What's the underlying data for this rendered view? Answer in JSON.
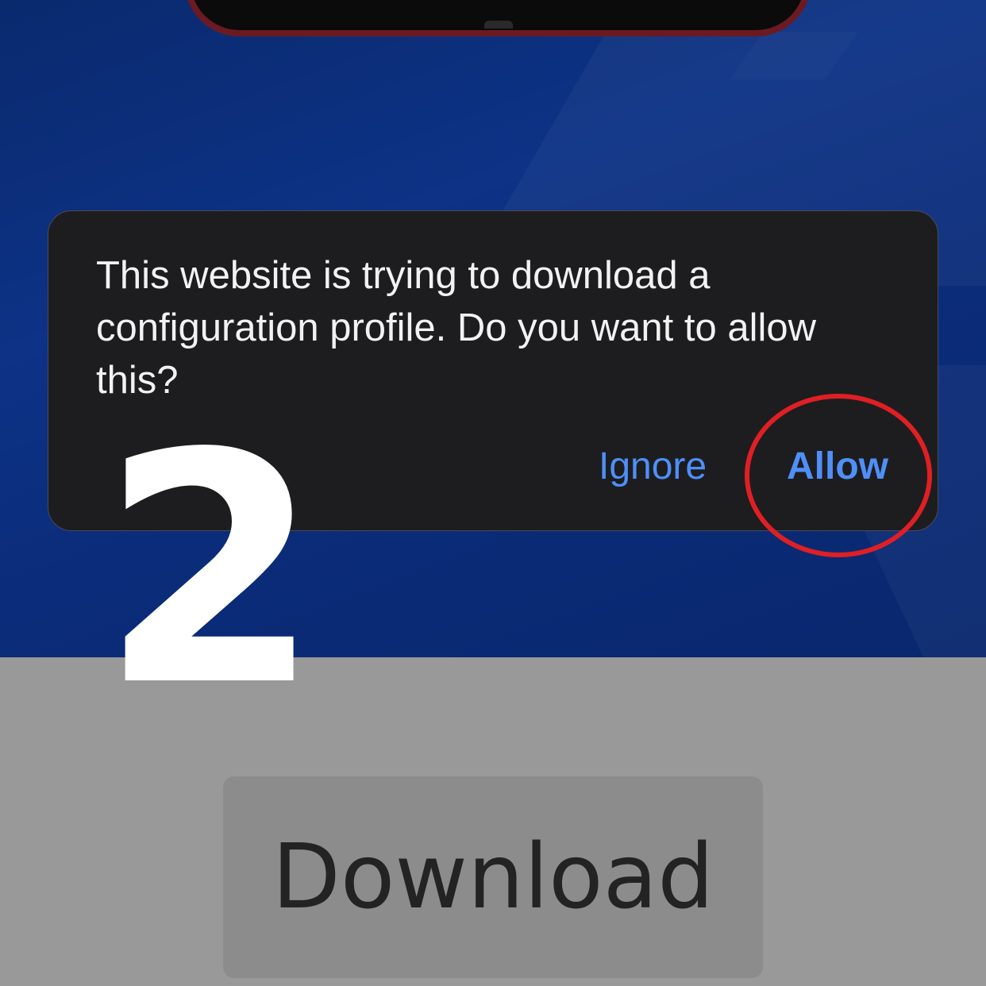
{
  "alert": {
    "message": "This website is trying to download a configuration profile. Do you want to allow this?",
    "ignore_label": "Ignore",
    "allow_label": "Allow"
  },
  "annotation": {
    "step_number": "2",
    "highlight_color": "#e01f24"
  },
  "page": {
    "download_label": "Download"
  },
  "colors": {
    "wallpaper": "#0d3286",
    "alert_background": "#1d1d1f",
    "button_text": "#4f8ff7",
    "page_background": "#999999"
  }
}
